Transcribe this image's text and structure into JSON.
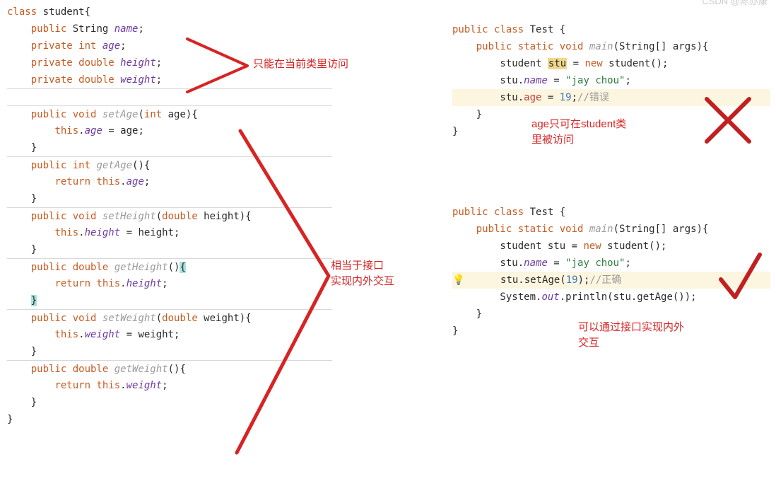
{
  "left": {
    "l1": "class student{",
    "l2": "    public String name;",
    "l3": "    private int age;",
    "l4": "    private double height;",
    "l5": "    private double weight;",
    "l6": "",
    "l7": "    public void setAge(int age){",
    "l8": "        this.age = age;",
    "l9": "    }",
    "l10": "    public int getAge(){",
    "l11": "        return this.age;",
    "l12": "    }",
    "l13": "    public void setHeight(double height){",
    "l14": "        this.height = height;",
    "l15": "    }",
    "l16": "    public double getHeight(){",
    "l17": "        return this.height;",
    "l18": "    }",
    "l19": "    public void setWeight(double weight){",
    "l20": "        this.weight = weight;",
    "l21": "    }",
    "l22": "    public double getWeight(){",
    "l23": "        return this.weight;",
    "l24": "    }",
    "l25": "}"
  },
  "right1": {
    "l1": "public class Test {",
    "l2": "    public static void main(String[] args){",
    "l3": "        student stu = new student();",
    "l4": "        stu.name = \"jay chou\";",
    "l5a": "        stu.",
    "l5b": "age",
    "l5c": " = ",
    "l5d": "19",
    "l5e": ";",
    "l5f": "//错误",
    "l6": "    }",
    "l7": "}"
  },
  "right2": {
    "l1": "public class Test {",
    "l2": "    public static void main(String[] args){",
    "l3": "        student stu = new student();",
    "l4": "        stu.name = \"jay chou\";",
    "l5a": "        stu.setAge(",
    "l5b": "19",
    "l5c": ");",
    "l5d": "//正确",
    "l6": "        System.out.println(stu.getAge());",
    "l7": "    }",
    "l8": "}"
  },
  "annotations": {
    "a1": "只能在当前类里访问",
    "a2": "相当于接口\n实现内外交互",
    "a3": "age只可在student类\n里被访问",
    "a4": "可以通过接口实现内外\n交互"
  },
  "watermark": "CSDN @陈亦康",
  "bulb": "💡"
}
